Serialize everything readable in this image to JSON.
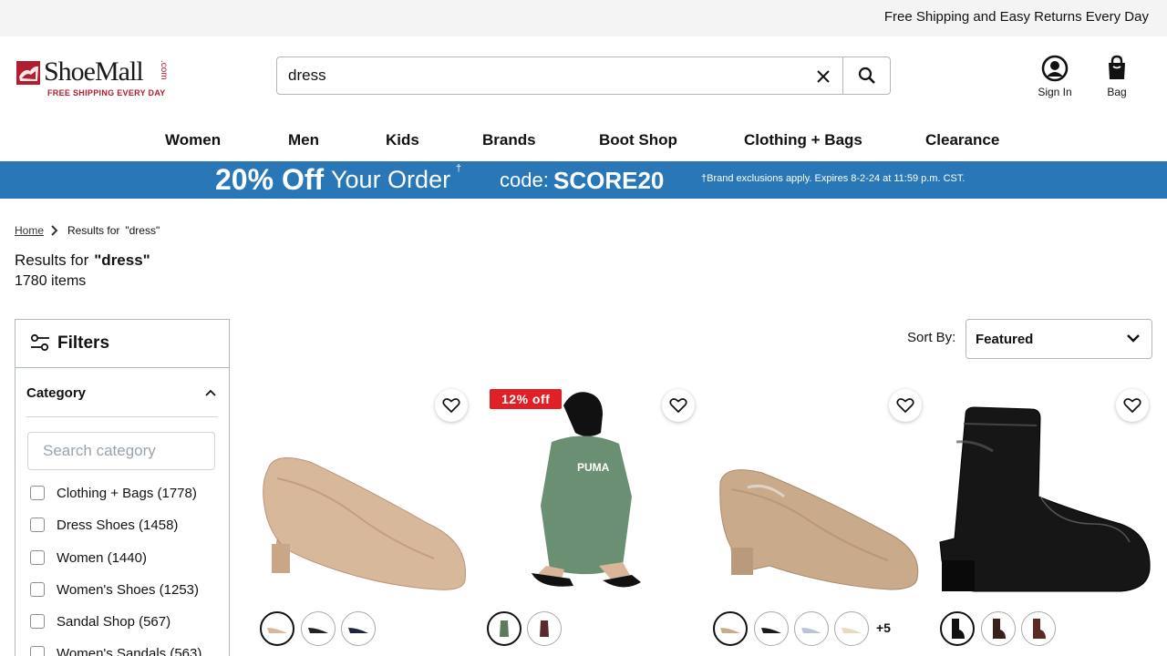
{
  "topbar": {
    "text": "Free Shipping and Easy Returns Every Day"
  },
  "logo": {
    "brand": "ShoeMall",
    "suffix": ".com",
    "tagline": "FREE SHIPPING EVERY DAY",
    "icon": "shoemall-logo-icon"
  },
  "search": {
    "value": "dress",
    "clear_icon": "close-icon",
    "submit_icon": "search-icon"
  },
  "account": {
    "signin_label": "Sign In",
    "signin_icon": "user-circle-icon",
    "bag_label": "Bag",
    "bag_icon": "shopping-bag-icon"
  },
  "nav": {
    "items": [
      "Women",
      "Men",
      "Kids",
      "Brands",
      "Boot Shop",
      "Clothing + Bags",
      "Clearance"
    ]
  },
  "promo": {
    "headline": "20% Off",
    "headline_rest": "Your Order",
    "dagger": "†",
    "code_label": "code:",
    "code": "SCORE20",
    "fine_print": "†Brand exclusions apply. Expires 8-2-24 at 11:59 p.m. CST.",
    "background": "#2a77b8"
  },
  "breadcrumb": {
    "home": "Home",
    "current_prefix": "Results for",
    "current_query": "\"dress\""
  },
  "results": {
    "prefix": "Results for",
    "query": "\"dress\"",
    "count": "1780 items"
  },
  "filters": {
    "title": "Filters",
    "section": "Category",
    "search_placeholder": "Search category",
    "options": [
      {
        "label": "Clothing + Bags",
        "count": "(1778)"
      },
      {
        "label": "Dress Shoes",
        "count": "(1458)"
      },
      {
        "label": "Women",
        "count": "(1440)"
      },
      {
        "label": "Women's Shoes",
        "count": "(1253)"
      },
      {
        "label": "Sandal Shop",
        "count": "(567)"
      },
      {
        "label": "Women's Sandals",
        "count": "(563)"
      }
    ]
  },
  "sort": {
    "label": "Sort By:",
    "value": "Featured"
  },
  "products": [
    {
      "badge": null,
      "image": "nude-block-heel-pump",
      "swatch_colors": [
        "#d8b89a",
        "#222222",
        "#1e2440"
      ],
      "more": null
    },
    {
      "badge": "12% off",
      "image": "green-tshirt-dress-model",
      "swatch_colors": [
        "#5c7a5e",
        "#5a2a30"
      ],
      "more": null
    },
    {
      "badge": null,
      "image": "nude-patent-pump",
      "swatch_colors": [
        "#c9ab8c",
        "#1b1b1b",
        "#b9c4d6",
        "#e8dcc0"
      ],
      "more": "+5"
    },
    {
      "badge": null,
      "image": "black-western-boot",
      "swatch_colors": [
        "#111111",
        "#3a1f1a",
        "#5c2a24"
      ],
      "more": null
    }
  ],
  "colors": {
    "accent_red": "#e02027",
    "brand_red": "#b01e2f"
  }
}
